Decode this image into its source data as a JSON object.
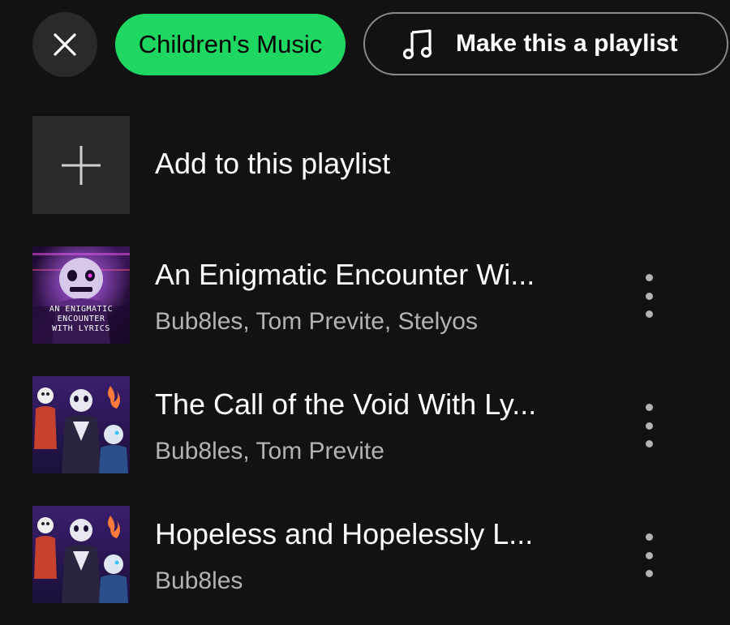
{
  "header": {
    "close_icon": "close-icon",
    "genre_chip": "Children's Music",
    "make_playlist_label": "Make this a playlist",
    "make_playlist_icon": "music-note-icon"
  },
  "add_row": {
    "label": "Add to this playlist",
    "icon": "plus-icon"
  },
  "tracks": [
    {
      "title": "An Enigmatic Encounter Wi...",
      "artists": "Bub8les, Tom Previte, Stelyos",
      "art_text": [
        "AN ENIGMATIC",
        "ENCOUNTER",
        "WITH LYRICS"
      ]
    },
    {
      "title": "The Call of the Void With Ly...",
      "artists": "Bub8les, Tom Previte"
    },
    {
      "title": "Hopeless and Hopelessly L...",
      "artists": "Bub8les"
    }
  ],
  "colors": {
    "background": "#121212",
    "accent_green": "#1ed760",
    "secondary_text": "#b3b3b3",
    "tile": "#2a2a2a"
  }
}
